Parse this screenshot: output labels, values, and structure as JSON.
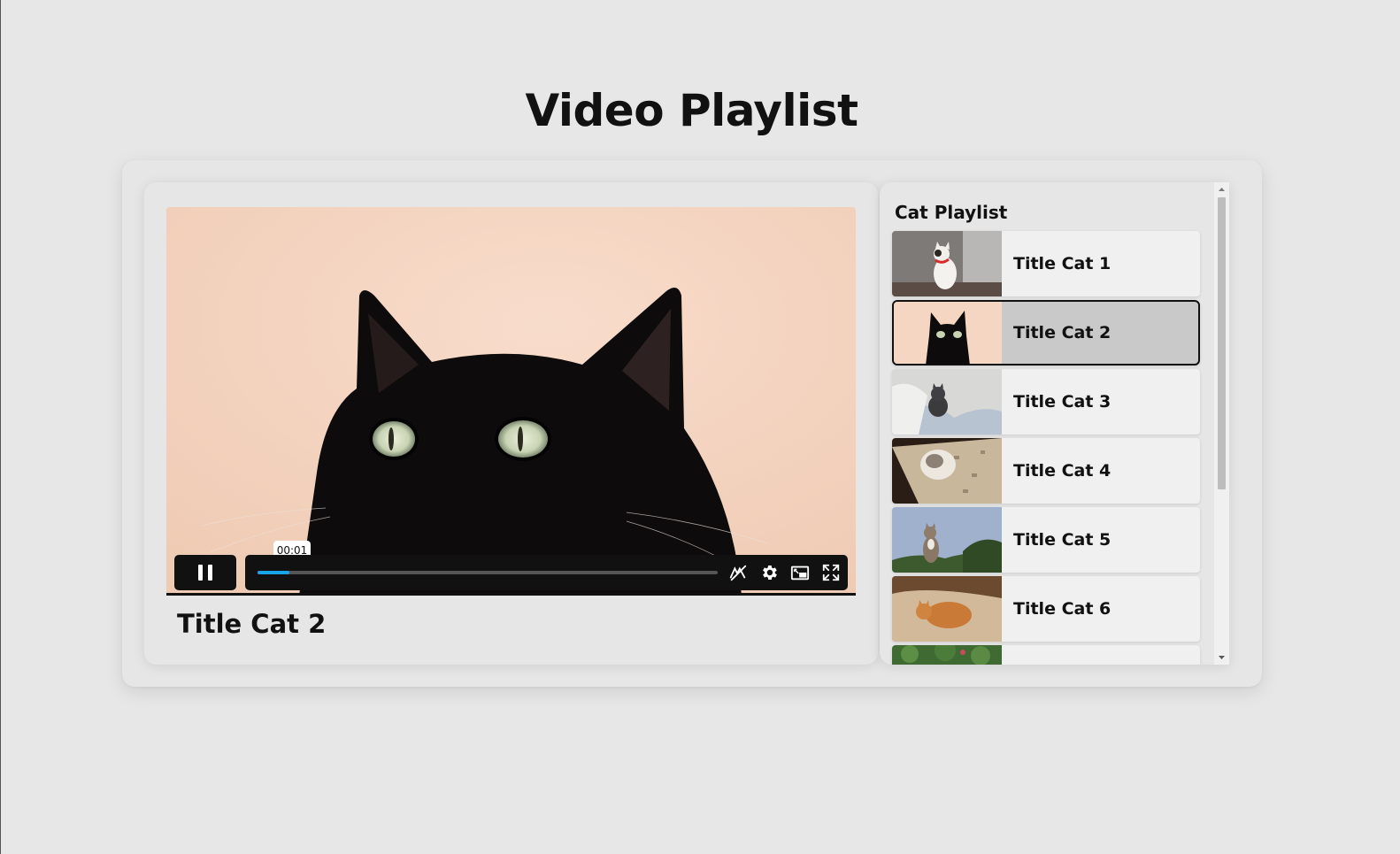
{
  "page": {
    "title": "Video Playlist"
  },
  "player": {
    "now_playing_title": "Title Cat 2",
    "current_time": "00:01",
    "progress_fraction": 0.07,
    "accent_color": "#1aa4e8",
    "icons": [
      "pause-icon",
      "captions-off-icon",
      "gear-icon",
      "picture-in-picture-icon",
      "fullscreen-icon"
    ]
  },
  "playlist": {
    "heading": "Cat Playlist",
    "active_index": 1,
    "items": [
      {
        "label": "Title Cat 1"
      },
      {
        "label": "Title Cat 2"
      },
      {
        "label": "Title Cat 3"
      },
      {
        "label": "Title Cat 4"
      },
      {
        "label": "Title Cat 5"
      },
      {
        "label": "Title Cat 6"
      },
      {
        "label": ""
      }
    ]
  }
}
